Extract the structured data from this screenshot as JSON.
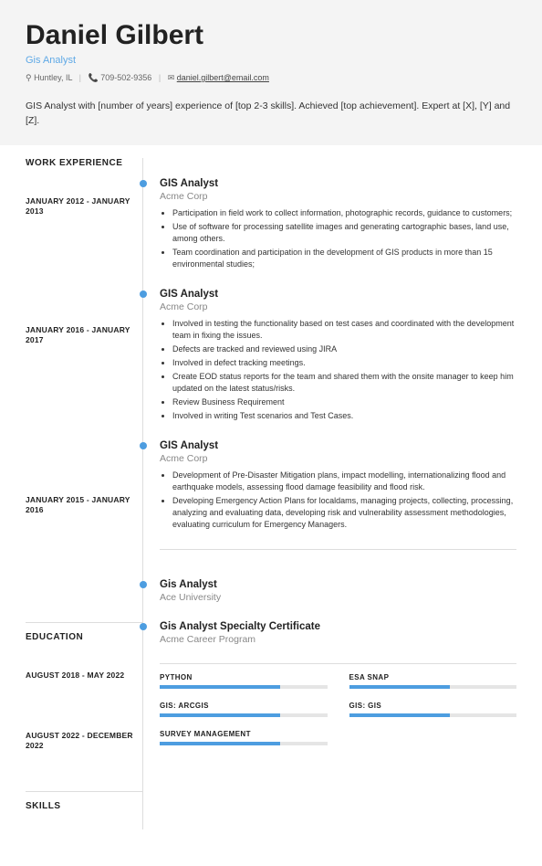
{
  "header": {
    "name": "Daniel Gilbert",
    "title": "Gis Analyst",
    "location": "Huntley, IL",
    "phone": "709-502-9356",
    "email": "daniel.gilbert@email.com"
  },
  "summary": "GIS Analyst with [number of years] experience of [top 2-3 skills]. Achieved [top achievement]. Expert at [X], [Y] and [Z].",
  "sections": {
    "work": "WORK EXPERIENCE",
    "edu": "EDUCATION",
    "skills": "SKILLS"
  },
  "jobs": [
    {
      "date": "JANUARY 2012 - JANUARY 2013",
      "title": "GIS Analyst",
      "company": "Acme Corp",
      "bullets": [
        "Participation in field work to collect information, photographic records, guidance to customers;",
        "Use of software for processing satellite images and generating cartographic bases, land use, among others.",
        "Team coordination and participation in the development of GIS products in more than 15 environmental studies;"
      ]
    },
    {
      "date": "JANUARY 2016 - JANUARY 2017",
      "title": "GIS Analyst",
      "company": "Acme Corp",
      "bullets": [
        "Involved in testing the functionality based on test cases and coordinated with the development team in fixing the issues.",
        "Defects are tracked and reviewed using JIRA",
        "Involved in defect tracking meetings.",
        "Create EOD status reports for the team and shared them with the onsite manager to keep him updated on the latest status/risks.",
        "Review Business Requirement",
        "Involved in writing Test scenarios and Test Cases."
      ]
    },
    {
      "date": "JANUARY 2015 - JANUARY 2016",
      "title": "GIS Analyst",
      "company": "Acme Corp",
      "bullets": [
        "Development of Pre-Disaster Mitigation plans, impact modelling, internationalizing flood and earthquake models, assessing flood damage feasibility and flood risk.",
        "Developing Emergency Action Plans for localdams, managing projects, collecting, processing, analyzing and evaluating data, developing risk and vulnerability assessment methodologies, evaluating curriculum for Emergency Managers."
      ]
    }
  ],
  "edu": [
    {
      "date": "AUGUST 2018 - MAY 2022",
      "title": "Gis Analyst",
      "school": "Ace University"
    },
    {
      "date": "AUGUST 2022 - DECEMBER 2022",
      "title": "Gis Analyst Specialty Certificate",
      "school": "Acme Career Program"
    }
  ],
  "skills": [
    {
      "name": "PYTHON",
      "level": 72
    },
    {
      "name": "ESA SNAP",
      "level": 60
    },
    {
      "name": "GIS: ARCGIS",
      "level": 72
    },
    {
      "name": "GIS: GIS",
      "level": 60
    },
    {
      "name": "SURVEY MANAGEMENT",
      "level": 72
    }
  ]
}
